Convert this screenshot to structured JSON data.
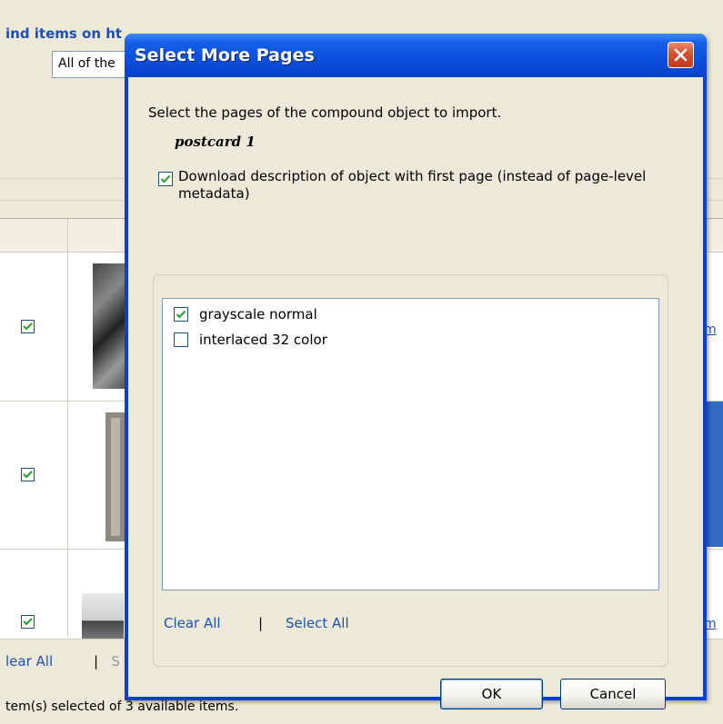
{
  "background": {
    "find_title": "ind items on ht",
    "scope_select_value": "All of the",
    "row_link_text": "m",
    "footer": {
      "clear_all": "lear All",
      "separator": "|",
      "select_all_partial": "S"
    },
    "status_text": "tem(s) selected of 3 available items.",
    "rows": [
      {
        "checked": true
      },
      {
        "checked": true
      },
      {
        "checked": true
      }
    ]
  },
  "dialog": {
    "title": "Select More Pages",
    "close_icon": "close-icon",
    "instruction": "Select the pages of the compound object to import.",
    "object_name": "postcard 1",
    "download_description": {
      "checked": true,
      "label": "Download description of object with first page (instead of page-level metadata)"
    },
    "pages": [
      {
        "label": "grayscale normal",
        "checked": true
      },
      {
        "label": "interlaced 32 color",
        "checked": false
      }
    ],
    "links": {
      "clear_all": "Clear All",
      "separator": "|",
      "select_all": "Select All"
    },
    "buttons": {
      "ok": "OK",
      "cancel": "Cancel"
    }
  },
  "colors": {
    "xp_title_blue": "#0a4fdc",
    "dialog_face": "#ece9d8",
    "link_blue": "#1c4fb8",
    "close_red": "#d7512f",
    "checkmark_green": "#21a121"
  }
}
